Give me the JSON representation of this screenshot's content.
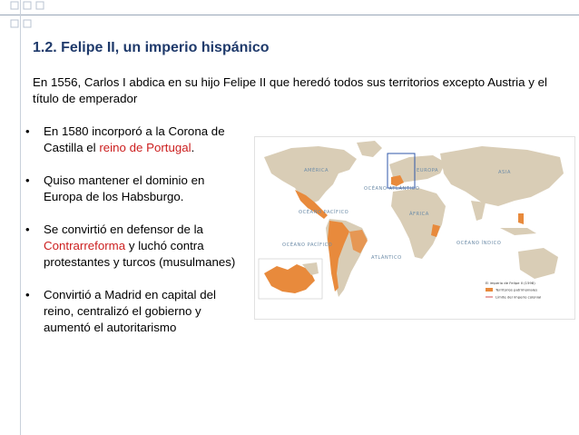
{
  "slide": {
    "title": "1.2. Felipe II, un imperio hispánico",
    "intro": "En 1556, Carlos I abdica en su hijo Felipe II que heredó todos sus territorios excepto Austria y el título de emperador",
    "bullets": [
      {
        "parts": [
          "En 1580 incorporó a la Corona de Castilla el ",
          "reino de Portugal",
          "."
        ]
      },
      {
        "text": "Quiso mantener el dominio en Europa de los Habsburgo."
      },
      {
        "parts": [
          "Se convirtió en defensor de la ",
          "Contrarreforma",
          " y luchó contra protestantes y turcos (musulmanes)"
        ]
      },
      {
        "text": "Convirtió a Madrid en capital del reino, centralizó el gobierno y aumentó el autoritarismo"
      }
    ],
    "accent_red": "#cc1f1f",
    "title_color": "#1f3a6b"
  },
  "map": {
    "labels": {
      "atlantico": "OCÉANO ATLÁNTICO",
      "pacifico_n": "OCÉANO PACÍFICO",
      "pacifico_s": "OCÉANO PACÍFICO",
      "indico": "OCÉANO ÍNDICO",
      "america": "AMÉRICA",
      "europa": "EUROPA",
      "africa": "ÁFRICA",
      "asia": "ASIA",
      "atlantico_s": "ATLÁNTICO"
    },
    "legend": [
      "El imperio de Felipe II (1598)",
      "Territorios patrimoniales",
      "Límite del imperio colonial"
    ],
    "colors": {
      "land": "#d9cdb6",
      "empire": "#e88a3c",
      "sea": "#ffffff",
      "inset_box": "#2f57a8"
    }
  }
}
